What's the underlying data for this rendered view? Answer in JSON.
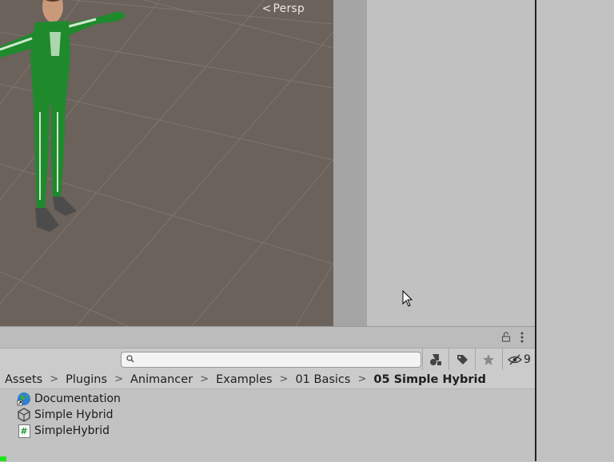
{
  "scene": {
    "camera_mode_label": "Persp",
    "background_color": "#6b625b",
    "character_color": "#1e8a2c"
  },
  "project": {
    "search_placeholder": "",
    "hidden_count": "9",
    "toolbar_icons": [
      "filter-by-type-icon",
      "filter-by-label-icon",
      "favorite-star-icon",
      "visibility-eye-icon"
    ],
    "breadcrumb": [
      "Assets",
      "Plugins",
      "Animancer",
      "Examples",
      "01 Basics",
      "05 Simple Hybrid"
    ],
    "items": [
      {
        "label": "Documentation",
        "icon": "globe-link-icon"
      },
      {
        "label": "Simple Hybrid",
        "icon": "unity-scene-icon"
      },
      {
        "label": "SimpleHybrid",
        "icon": "csharp-script-icon"
      }
    ]
  }
}
